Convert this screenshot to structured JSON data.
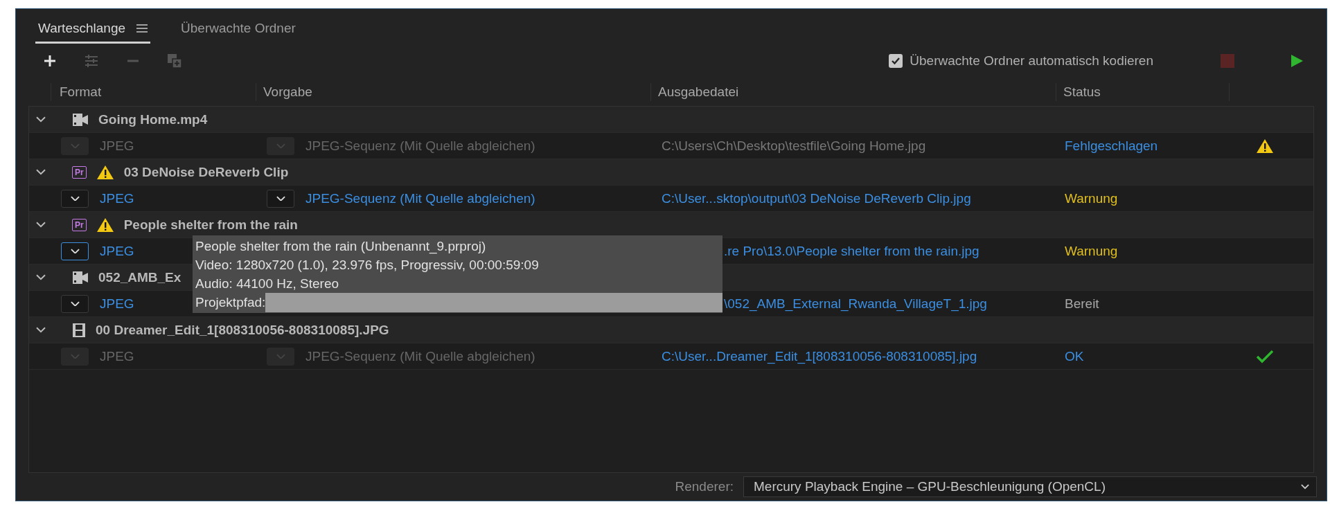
{
  "tabs": [
    {
      "label": "Warteschlange",
      "selected": true,
      "menu": true
    },
    {
      "label": "Überwachte Ordner",
      "selected": false,
      "menu": false
    }
  ],
  "toolbar": {
    "tools": [
      {
        "kind": "add",
        "disabled": false
      },
      {
        "kind": "preset",
        "disabled": true
      },
      {
        "kind": "remove",
        "disabled": true
      },
      {
        "kind": "duplicate",
        "disabled": true
      }
    ],
    "auto_encode": {
      "label": "Überwachte Ordner automatisch kodieren",
      "checked": true
    },
    "stop": {
      "disabled": true
    },
    "start": {
      "disabled": false
    }
  },
  "table": {
    "columns": [
      "Format",
      "Vorgabe",
      "Ausgabedatei",
      "Status"
    ],
    "groups": [
      {
        "name": "Going Home.mp4",
        "kind": "film",
        "warning": false,
        "expanded": true,
        "item": {
          "format": "JPEG",
          "preset": "JPEG-Sequenz (Mit Quelle abgleichen)",
          "output": "C:\\Users\\Ch\\Desktop\\testfile\\Going Home.jpg",
          "status": "Fehlgeschlagen",
          "kind": "failed",
          "disabled": true,
          "focused": false,
          "under_tooltip": false
        }
      },
      {
        "name": "03 DeNoise DeReverb Clip",
        "kind": "premiere",
        "badge": "Pr",
        "warning": true,
        "expanded": true,
        "item": {
          "format": "JPEG",
          "preset": "JPEG-Sequenz (Mit Quelle abgleichen)",
          "output": "C:\\User...sktop\\output\\03 DeNoise DeReverb Clip.jpg",
          "status": "Warnung",
          "kind": "warning",
          "disabled": false,
          "focused": false,
          "under_tooltip": false
        }
      },
      {
        "name": "People shelter from the rain",
        "kind": "premiere",
        "badge": "Pr",
        "warning": true,
        "expanded": true,
        "item": {
          "format": "JPEG",
          "output": ".re Pro\\13.0\\People shelter from the rain.jpg",
          "status": "Warnung",
          "kind": "warning",
          "disabled": false,
          "focused": true,
          "under_tooltip": true
        }
      },
      {
        "name": "052_AMB_Ex",
        "kind": "film",
        "warning": false,
        "expanded": true,
        "item": {
          "format": "JPEG",
          "output": "\\052_AMB_External_Rwanda_VillageT_1.jpg",
          "status": "Bereit",
          "kind": "ready",
          "disabled": false,
          "focused": false,
          "under_tooltip": true
        }
      },
      {
        "name": "00 Dreamer_Edit_1[808310056-808310085].JPG",
        "kind": "sequence",
        "warning": false,
        "expanded": true,
        "item": {
          "format": "JPEG",
          "preset": "JPEG-Sequenz (Mit Quelle abgleichen)",
          "output": "C:\\User...Dreamer_Edit_1[808310056-808310085].jpg",
          "status": "OK",
          "kind": "done",
          "disabled": true,
          "focused": false,
          "under_tooltip": false
        }
      }
    ]
  },
  "tooltip": {
    "lines": [
      "People shelter from the rain (Unbenannt_9.prproj)",
      "Video: 1280x720 (1.0), 23.976 fps, Progressiv, 00:00:59:09",
      "Audio: 44100 Hz, Stereo"
    ],
    "path_label": "Projektpfad:"
  },
  "renderer": {
    "label": "Renderer:",
    "value": "Mercury Playback Engine – GPU-Beschleunigung (OpenCL)"
  }
}
